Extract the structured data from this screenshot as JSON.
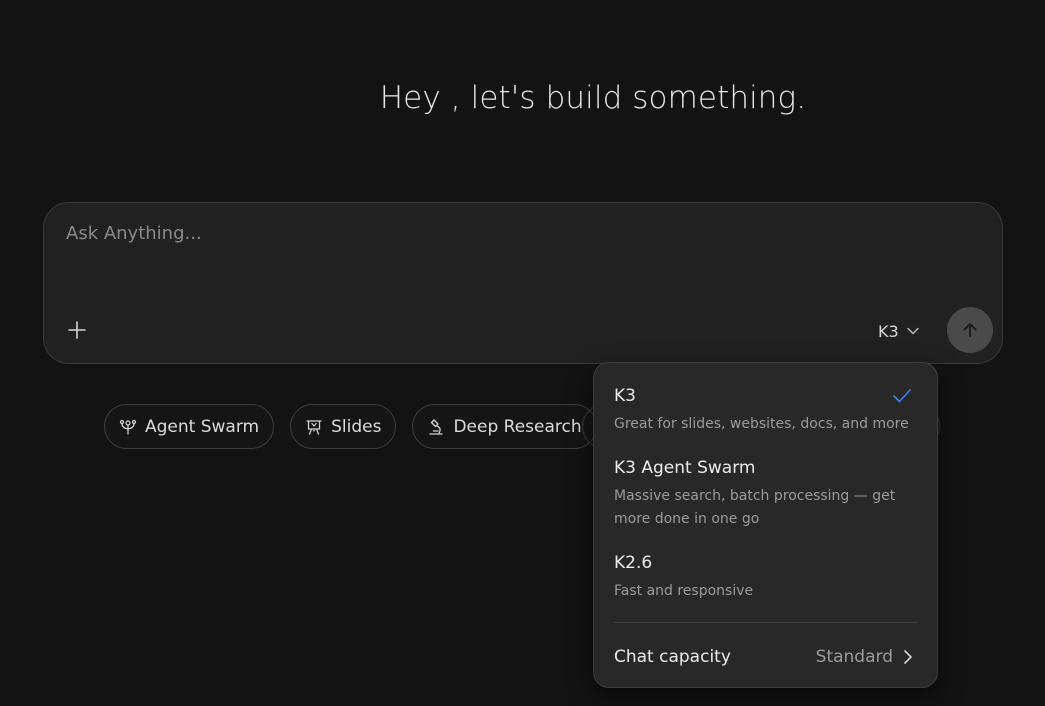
{
  "greeting": "Hey , let's build something.",
  "composer": {
    "placeholder": "Ask Anything...",
    "add_icon": "plus-icon",
    "model_label": "K3",
    "model_icon": "chevron-down-icon",
    "send_icon": "arrow-up-icon"
  },
  "chips": [
    {
      "label": "Agent Swarm",
      "icon": "agent-swarm-icon"
    },
    {
      "label": "Slides",
      "icon": "slides-icon"
    },
    {
      "label": "Deep Research",
      "icon": "microscope-icon"
    }
  ],
  "model_menu": {
    "options": [
      {
        "name": "K3",
        "description": "Great for slides, websites, docs, and more",
        "selected": true
      },
      {
        "name": "K3 Agent Swarm",
        "description": "Massive search, batch processing — get more done in one go",
        "selected": false
      },
      {
        "name": "K2.6",
        "description": "Fast and responsive",
        "selected": false
      }
    ],
    "capacity_label": "Chat capacity",
    "capacity_value": "Standard"
  },
  "colors": {
    "background": "#131313",
    "composer": "#212121",
    "menu": "#282828",
    "accent": "#3b82f6",
    "send_button": "#4a4a4a"
  }
}
